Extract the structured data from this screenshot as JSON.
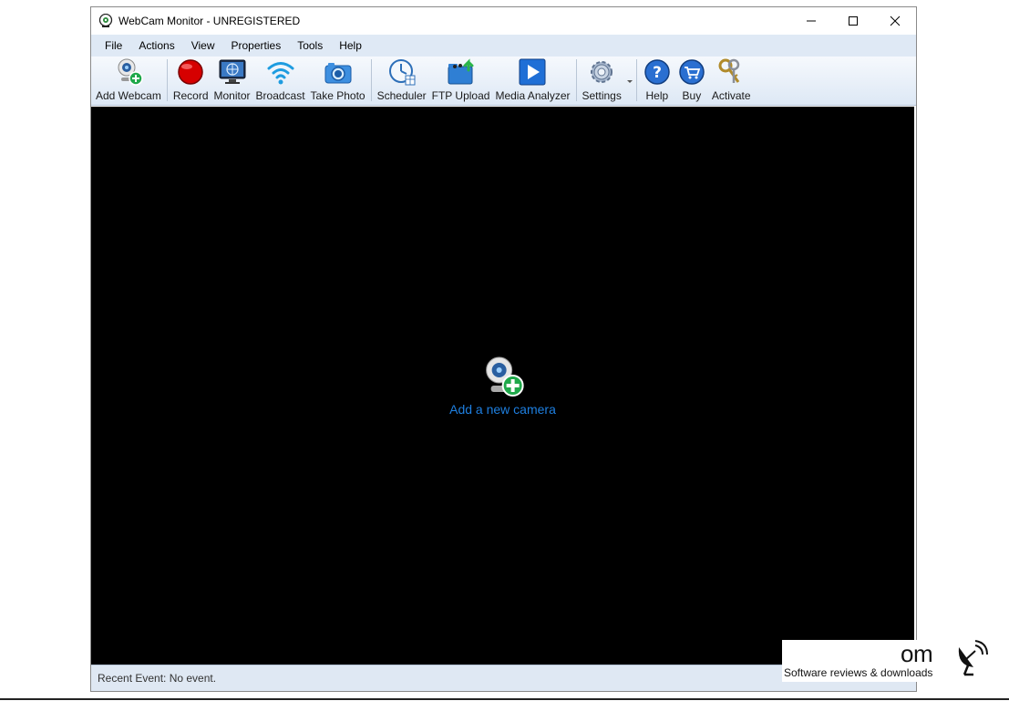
{
  "window": {
    "title": "WebCam Monitor - UNREGISTERED"
  },
  "menu": [
    "File",
    "Actions",
    "View",
    "Properties",
    "Tools",
    "Help"
  ],
  "toolbar": {
    "add_webcam": "Add Webcam",
    "record": "Record",
    "monitor": "Monitor",
    "broadcast": "Broadcast",
    "take_photo": "Take Photo",
    "scheduler": "Scheduler",
    "ftp_upload": "FTP Upload",
    "media_analyzer": "Media Analyzer",
    "settings": "Settings",
    "help": "Help",
    "buy": "Buy",
    "activate": "Activate"
  },
  "viewport": {
    "add_camera_label": "Add a new camera"
  },
  "status": {
    "text": "Recent Event: No event."
  },
  "watermark": {
    "tail": "om",
    "tagline": "Software reviews & downloads"
  },
  "colors": {
    "accent_link": "#1e7fe0",
    "viewport_bg": "#000000",
    "menubar_bg": "#dfe9f5"
  }
}
